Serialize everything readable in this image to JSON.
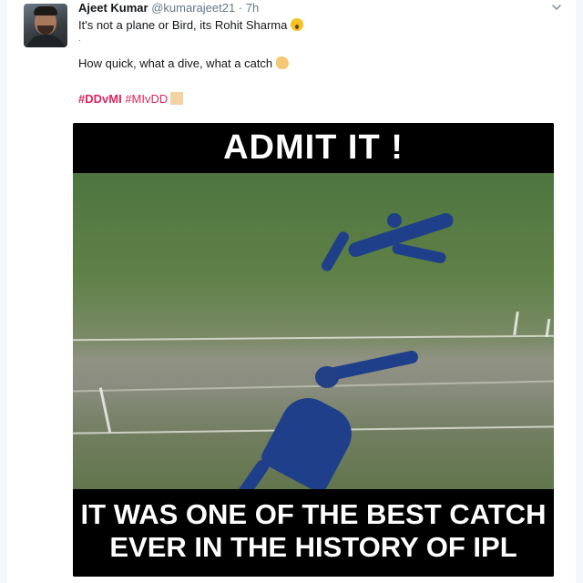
{
  "tweet": {
    "author": {
      "name": "Ajeet Kumar",
      "handle": "@kumarajeet21",
      "separator": "·",
      "time": "7h"
    },
    "text": {
      "line1": "It's not a plane or Bird, its Rohit Sharma",
      "line2": ".",
      "line3": "How quick, what a dive, what a catch",
      "hashtag1": "#DDvMI",
      "hashtag2": "#MIvDD"
    },
    "emojis": {
      "line1": "astonished-face-emoji",
      "line3": "clapping-hands-emoji",
      "line4": "tan-square-emoji"
    },
    "colors": {
      "hashtag": "#e0245e",
      "name": "#14171a",
      "meta": "#657786",
      "jersey": "#1f3f8a"
    }
  },
  "media": {
    "caption_top": "ADMIT IT !",
    "caption_bottom_line1": "IT WAS ONE OF THE BEST CATCH",
    "caption_bottom_line2": "EVER IN THE HISTORY OF IPL"
  }
}
